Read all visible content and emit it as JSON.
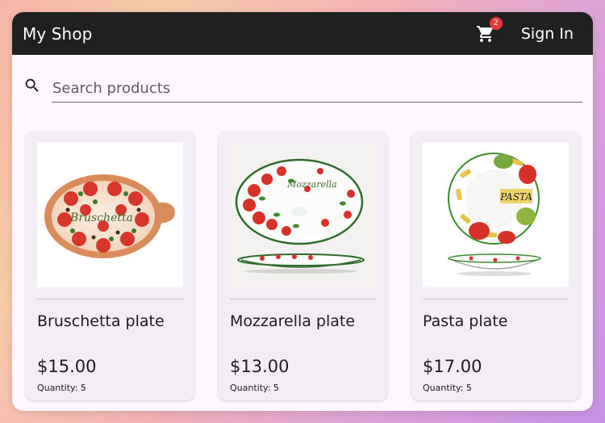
{
  "header": {
    "brand": "My Shop",
    "cart_count": "2",
    "signin_label": "Sign In"
  },
  "search": {
    "placeholder": "Search products"
  },
  "products": [
    {
      "name": "Bruschetta plate",
      "price": "$15.00",
      "quantity": "Quantity: 5",
      "image_text": "Bruschetta"
    },
    {
      "name": "Mozzarella plate",
      "price": "$13.00",
      "quantity": "Quantity: 5",
      "image_text": "Mozzarella"
    },
    {
      "name": "Pasta plate",
      "price": "$17.00",
      "quantity": "Quantity: 5",
      "image_text": "PASTA"
    }
  ],
  "colors": {
    "topbar": "#202020",
    "badge": "#e53935",
    "page": "#fef7ff",
    "card": "#f3edf6"
  }
}
